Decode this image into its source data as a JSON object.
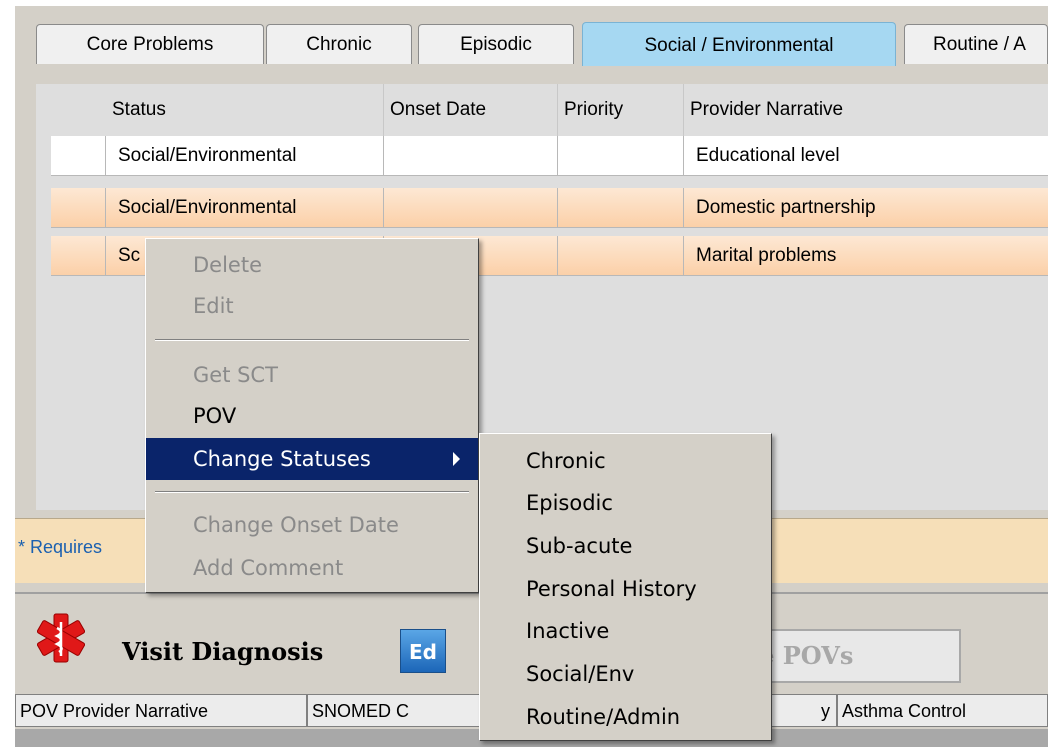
{
  "tabs": [
    {
      "label": "Core Problems",
      "active": false
    },
    {
      "label": "Chronic",
      "active": false
    },
    {
      "label": "Episodic",
      "active": false
    },
    {
      "label": "Social / Environmental",
      "active": true
    },
    {
      "label": "Routine / A",
      "active": false
    }
  ],
  "grid": {
    "headers": [
      "Status",
      "Onset Date",
      "Priority",
      "Provider Narrative"
    ],
    "rows": [
      {
        "status": "Social/Environmental",
        "onset": "",
        "priority": "",
        "narrative": "Educational level"
      },
      {
        "status": "Social/Environmental",
        "onset": "",
        "priority": "",
        "narrative": "Domestic partnership"
      },
      {
        "status": "Sc",
        "onset": "",
        "priority": "",
        "narrative": "Marital problems"
      }
    ]
  },
  "requires_text": "* Requires",
  "context_menu": {
    "delete": "Delete",
    "edit": "Edit",
    "get_sct": "Get SCT",
    "pov": "POV",
    "change_statuses": "Change Statuses",
    "change_onset": "Change Onset Date",
    "add_comment": "Add Comment"
  },
  "submenu": [
    "Chronic",
    "Episodic",
    "Sub-acute",
    "Personal History",
    "Inactive",
    "Social/Env",
    "Routine/Admin"
  ],
  "visit": {
    "title": "Visit Diagnosis",
    "ed_label": "Ed",
    "update_label": "te POVs",
    "columns": [
      "POV Provider Narrative",
      "SNOMED C",
      "y",
      "Asthma Control"
    ]
  },
  "colors": {
    "accent_tab": "#a6d8f2",
    "selection": "#0a246a",
    "row_highlight": "#fbd0a8",
    "requires_bar": "#f6dfb8"
  }
}
